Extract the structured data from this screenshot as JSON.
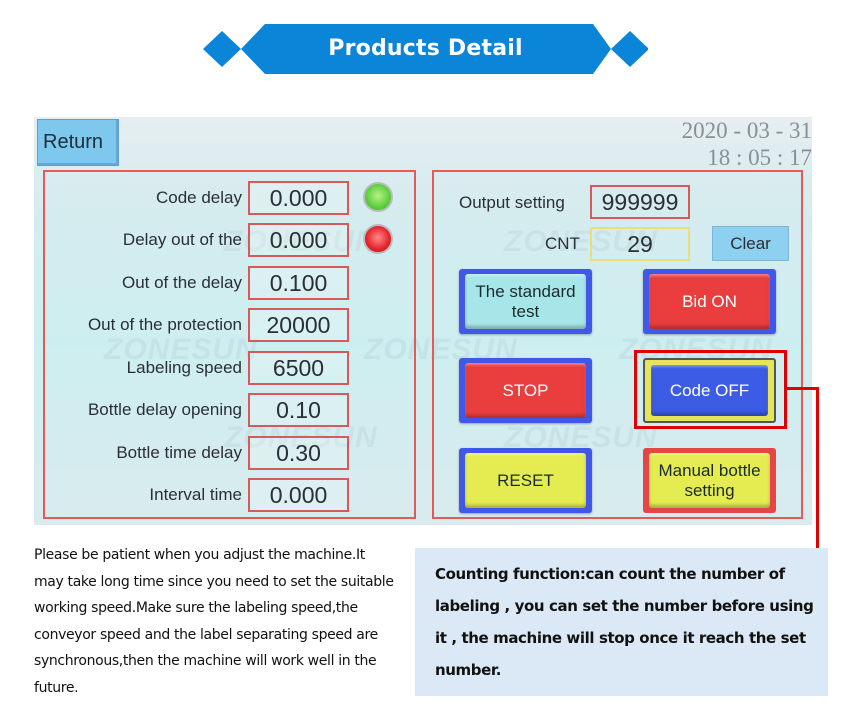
{
  "banner": {
    "title": "Products Detail",
    "color": "#0b85d8"
  },
  "hmi": {
    "return_label": "Return",
    "date": "2020 - 03 - 31",
    "time": "18 : 05 : 17",
    "watermark": "ZONESUN",
    "parameters": [
      {
        "label": "Code delay",
        "value": "0.000",
        "lamp": "green"
      },
      {
        "label": "Delay out of the",
        "value": "0.000",
        "lamp": "red"
      },
      {
        "label": "Out of the delay",
        "value": "0.100"
      },
      {
        "label": "Out of the protection",
        "value": "20000"
      },
      {
        "label": "Labeling speed",
        "value": "6500"
      },
      {
        "label": "Bottle delay opening",
        "value": "0.10"
      },
      {
        "label": "Bottle time delay",
        "value": "0.30"
      },
      {
        "label": "Interval time",
        "value": "0.000"
      }
    ],
    "output_setting": {
      "label": "Output setting",
      "value": "999999"
    },
    "counter": {
      "label": "CNT",
      "value": "29"
    },
    "clear_label": "Clear",
    "buttons": {
      "standard_test": "The standard test",
      "bid_on": "Bid ON",
      "stop": "STOP",
      "code_off": "Code OFF",
      "reset": "RESET",
      "manual_bottle": "Manual bottle setting"
    }
  },
  "notes": {
    "left": "Please be patient when you adjust the machine.It may take long time since you need to set the suitable working speed.Make sure the labeling speed,the conveyor speed and the label separating speed are synchronous,then the machine will work well in the future.",
    "callout": "Counting function:can count the number of labeling , you can set the number before using it , the machine will stop once it reach the set number."
  },
  "annotation_color": "#e00000"
}
